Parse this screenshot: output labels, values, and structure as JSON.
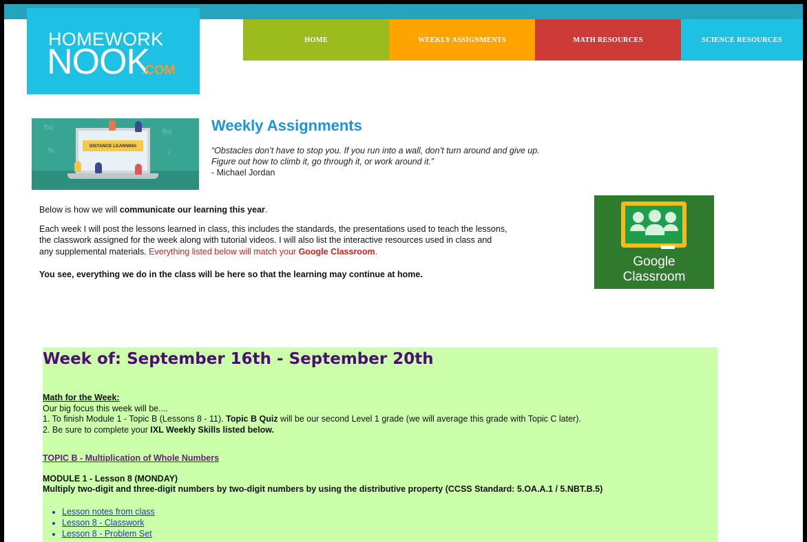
{
  "logo": {
    "line1": "HOMEWORK",
    "line2": "NOOK",
    "suffix": ".COM"
  },
  "nav": {
    "home": "HOME",
    "weekly": "WEEKLY ASSIGNMENTS",
    "math": "MATH RESOURCES",
    "science": "SCIENCE RESOURCES"
  },
  "hero_image": {
    "banner": "DISTANCE LEARNING"
  },
  "page_title": "Weekly Assignments",
  "quote": {
    "line1": "“Obstacles don’t have to stop you. If you run into a wall, don’t turn around and give up.",
    "line2": "Figure out how to climb it, go through it, or work around it.”",
    "author": "- Michael Jordan"
  },
  "communicate": {
    "p1_pre": "Below is how we will ",
    "p1_bold": "communicate our learning this year",
    "p1_post": ".",
    "p2_line1": "Each week I will post the lessons learned in class, this includes the standards, the presentations used to teach the lessons,",
    "p2_line2": "the classwork assigned for the week along with tutorial videos. I will also list the interactive resources used in class and",
    "p2_line3_pre": "any supplemental materials.  ",
    "p2_red": "Everything listed below will match your ",
    "p2_redbold": "Google Classroom",
    "p2_red_end": ".",
    "p3": "You see, everything we do in the class will be here so that the learning may continue at home."
  },
  "google_classroom": {
    "line1": "Google",
    "line2": "Classroom"
  },
  "week": {
    "title": "Week of: September 16th - September 20th",
    "math_header": "Math for the Week:",
    "focus": "Our big focus this week will be....",
    "item1_pre": "1. To finish Module 1 - Topic B (Lessons 8 - 11).  ",
    "item1_bold": "Topic B Quiz",
    "item1_post": " will be our second Level 1 grade (we will average this grade with Topic C later).",
    "item2_pre": "2. Be sure to complete your ",
    "item2_bold": "IXL Weekly Skills listed below.",
    "topic_link": "TOPIC B - Multiplication of Whole Numbers",
    "module_heading": "MODULE 1 - Lesson 8 (MONDAY)",
    "module_desc": "Multiply two-digit and three-digit numbers by two-digit numbers by using the distributive property (CCSS Standard: 5.OA.A.1 / 5.NBT.B.5)",
    "links": [
      "Lesson notes from class",
      "Lesson 8 - Classwork",
      "Lesson 8 - Problem Set"
    ]
  },
  "colors": {
    "nav_home": "#9bbb1e",
    "nav_weekly": "#ffa300",
    "nav_math": "#cd3b38",
    "nav_science": "#1ec0e4",
    "title_blue": "#1994dd",
    "week_bg": "#ccffaa",
    "week_title": "#4a0e74"
  }
}
